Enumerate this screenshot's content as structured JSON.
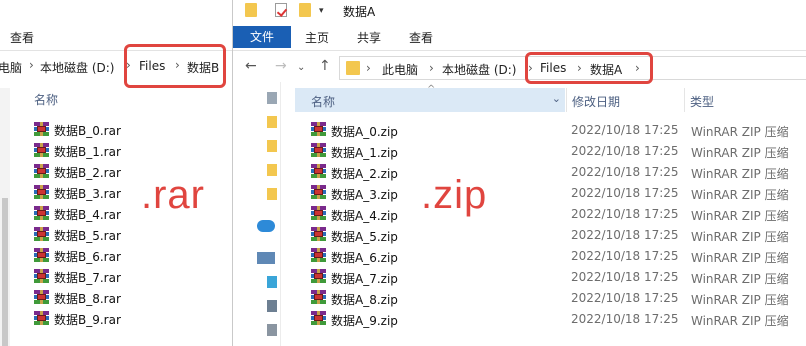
{
  "left_window": {
    "ribbon_tab": "查看",
    "breadcrumb": [
      "电脑",
      "本地磁盘 (D:)",
      "Files",
      "数据B"
    ],
    "column_name": "名称",
    "files": [
      "数据B_0.rar",
      "数据B_1.rar",
      "数据B_2.rar",
      "数据B_3.rar",
      "数据B_4.rar",
      "数据B_5.rar",
      "数据B_6.rar",
      "数据B_7.rar",
      "数据B_8.rar",
      "数据B_9.rar"
    ],
    "annotation": ".rar"
  },
  "right_window": {
    "title": "数据A",
    "ribbon": {
      "file": "文件",
      "home": "主页",
      "share": "共享",
      "view": "查看"
    },
    "breadcrumb": [
      "此电脑",
      "本地磁盘 (D:)",
      "Files",
      "数据A"
    ],
    "columns": {
      "name": "名称",
      "date": "修改日期",
      "type": "类型"
    },
    "files": [
      {
        "name": "数据A_0.zip",
        "date": "2022/10/18 17:25",
        "type": "WinRAR ZIP 压缩"
      },
      {
        "name": "数据A_1.zip",
        "date": "2022/10/18 17:25",
        "type": "WinRAR ZIP 压缩"
      },
      {
        "name": "数据A_2.zip",
        "date": "2022/10/18 17:25",
        "type": "WinRAR ZIP 压缩"
      },
      {
        "name": "数据A_3.zip",
        "date": "2022/10/18 17:25",
        "type": "WinRAR ZIP 压缩"
      },
      {
        "name": "数据A_4.zip",
        "date": "2022/10/18 17:25",
        "type": "WinRAR ZIP 压缩"
      },
      {
        "name": "数据A_5.zip",
        "date": "2022/10/18 17:25",
        "type": "WinRAR ZIP 压缩"
      },
      {
        "name": "数据A_6.zip",
        "date": "2022/10/18 17:25",
        "type": "WinRAR ZIP 压缩"
      },
      {
        "name": "数据A_7.zip",
        "date": "2022/10/18 17:25",
        "type": "WinRAR ZIP 压缩"
      },
      {
        "name": "数据A_8.zip",
        "date": "2022/10/18 17:25",
        "type": "WinRAR ZIP 压缩"
      },
      {
        "name": "数据A_9.zip",
        "date": "2022/10/18 17:25",
        "type": "WinRAR ZIP 压缩"
      }
    ],
    "annotation": ".zip"
  },
  "colors": {
    "highlight": "#e0453f",
    "ribbon_file": "#1a5fb4",
    "header_selected": "#dbe9f6"
  },
  "icons": [
    "folder-icon",
    "properties-icon",
    "back-arrow-icon",
    "forward-arrow-icon",
    "up-arrow-icon",
    "winrar-archive-icon"
  ]
}
